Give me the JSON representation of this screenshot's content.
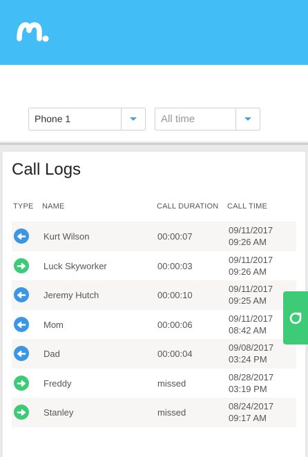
{
  "filters": {
    "device": "Phone 1",
    "period_placeholder": "All time"
  },
  "card": {
    "title": "Call Logs",
    "columns": [
      "TYPE",
      "NAME",
      "CALL DURATION",
      "CALL TIME"
    ]
  },
  "calls": [
    {
      "type": "incoming",
      "name": "Kurt Wilson",
      "duration": "00:00:07",
      "date": "09/11/2017",
      "time": "09:26 AM"
    },
    {
      "type": "outgoing",
      "name": "Luck Skyworker",
      "duration": "00:00:03",
      "date": "09/11/2017",
      "time": "09:26 AM"
    },
    {
      "type": "incoming",
      "name": "Jeremy Hutch",
      "duration": "00:00:10",
      "date": "09/11/2017",
      "time": "09:25 AM"
    },
    {
      "type": "incoming",
      "name": "Mom",
      "duration": "00:00:06",
      "date": "09/11/2017",
      "time": "08:42 AM"
    },
    {
      "type": "incoming",
      "name": "Dad",
      "duration": "00:00:04",
      "date": "09/08/2017",
      "time": "03:24 PM"
    },
    {
      "type": "outgoing",
      "name": "Freddy",
      "duration": "missed",
      "date": "08/28/2017",
      "time": "03:19 PM"
    },
    {
      "type": "outgoing",
      "name": "Stanley",
      "duration": "missed",
      "date": "08/24/2017",
      "time": "09:17 AM"
    }
  ],
  "colors": {
    "header": "#42bdf5",
    "incoming": "#3b97e3",
    "outgoing": "#3ecb77",
    "refresh": "#3ecb77"
  },
  "icons": {
    "logo": "mspy-logo",
    "incoming": "arrow-left-circle-icon",
    "outgoing": "arrow-right-circle-icon",
    "refresh": "refresh-icon",
    "dropdown": "caret-down-icon"
  }
}
